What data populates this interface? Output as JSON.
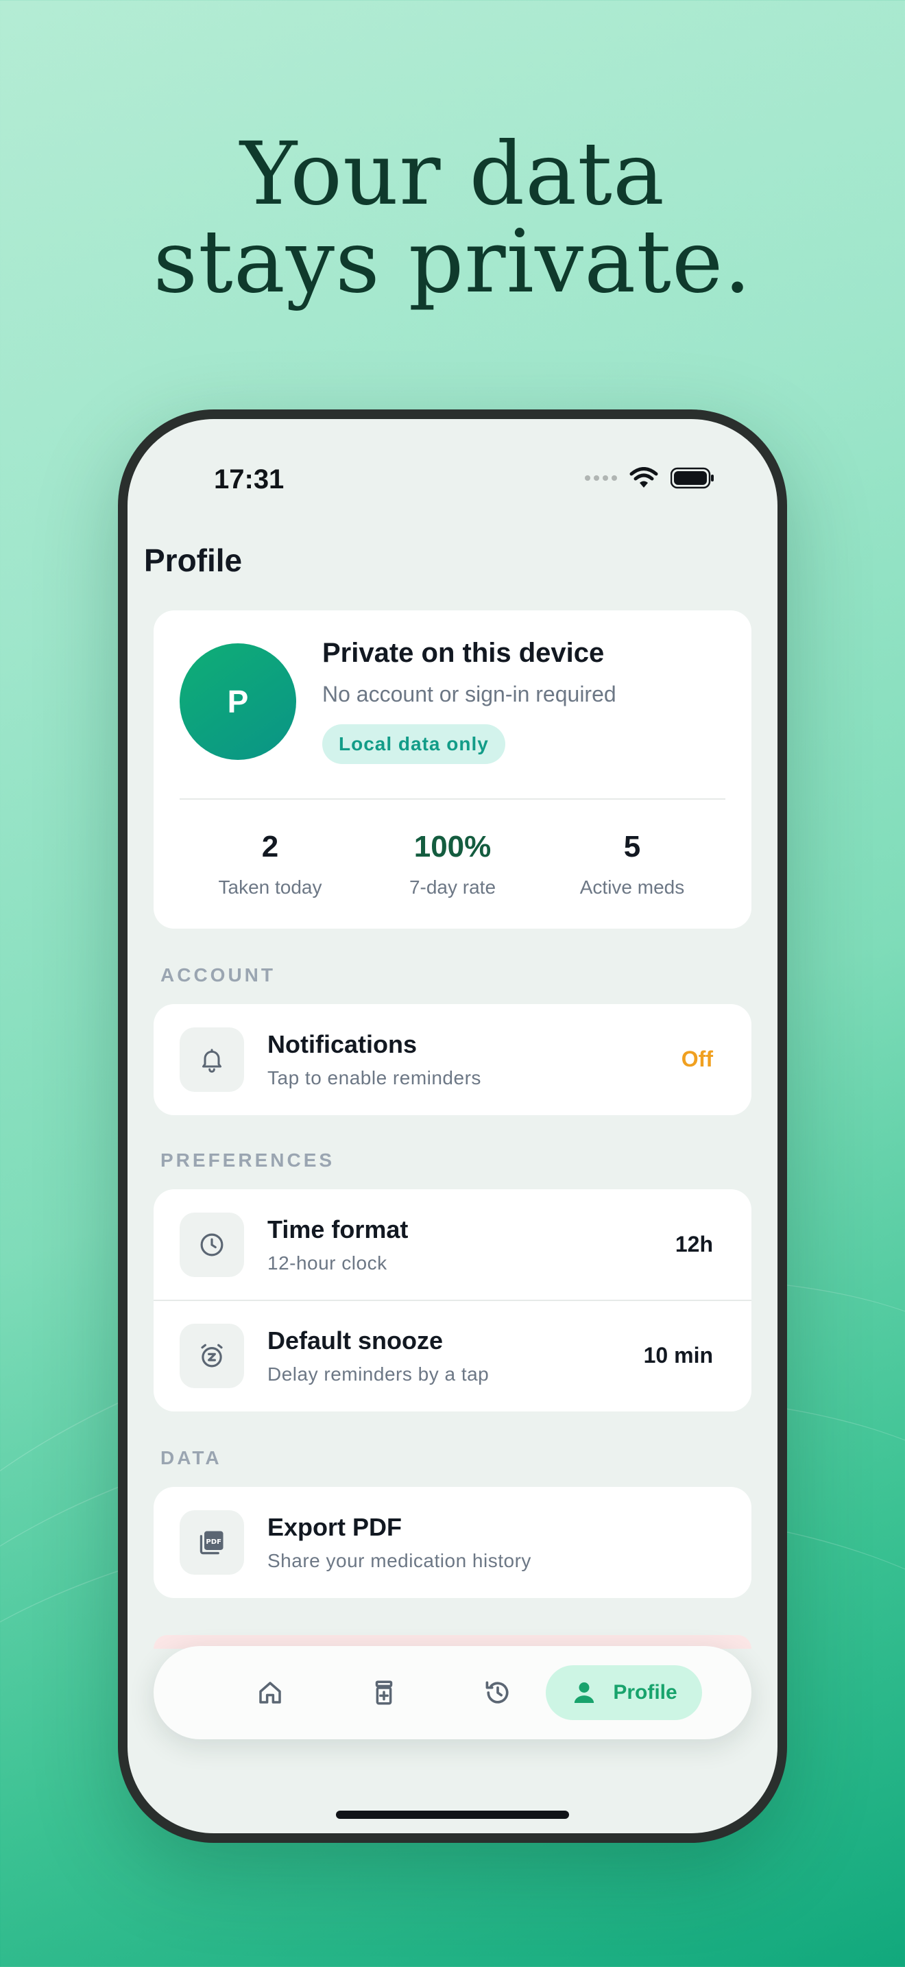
{
  "headline": {
    "line1": "Your data",
    "line2": "stays private."
  },
  "status_bar": {
    "time": "17:31"
  },
  "page": {
    "title": "Profile"
  },
  "profile_card": {
    "avatar_letter": "P",
    "title": "Private on this device",
    "subtitle": "No account or sign-in required",
    "badge": "Local data only",
    "stats": [
      {
        "value": "2",
        "label": "Taken today"
      },
      {
        "value": "100%",
        "label": "7-day rate"
      },
      {
        "value": "5",
        "label": "Active meds"
      }
    ]
  },
  "sections": {
    "account": {
      "label": "ACCOUNT",
      "rows": [
        {
          "title": "Notifications",
          "subtitle": "Tap to enable reminders",
          "value": "Off",
          "icon": "bell-icon"
        }
      ]
    },
    "preferences": {
      "label": "PREFERENCES",
      "rows": [
        {
          "title": "Time format",
          "subtitle": "12-hour clock",
          "value": "12h",
          "icon": "clock-icon"
        },
        {
          "title": "Default snooze",
          "subtitle": "Delay reminders by a tap",
          "value": "10 min",
          "icon": "snooze-alarm-icon"
        }
      ]
    },
    "data": {
      "label": "DATA",
      "rows": [
        {
          "title": "Export PDF",
          "subtitle": "Share your medication history",
          "icon": "pdf-icon",
          "icon_text": "PDF"
        }
      ]
    }
  },
  "tab_bar": {
    "tabs": [
      {
        "name": "home",
        "icon": "home-icon"
      },
      {
        "name": "medications",
        "icon": "pill-bottle-icon"
      },
      {
        "name": "history",
        "icon": "history-icon"
      },
      {
        "name": "profile",
        "icon": "person-icon",
        "label": "Profile",
        "active": true
      }
    ]
  },
  "colors": {
    "accent_green": "#18a36c",
    "warning_orange": "#f0a020",
    "headline": "#0f3a2c",
    "badge_bg": "#d3f3ec",
    "badge_text": "#129c88"
  }
}
